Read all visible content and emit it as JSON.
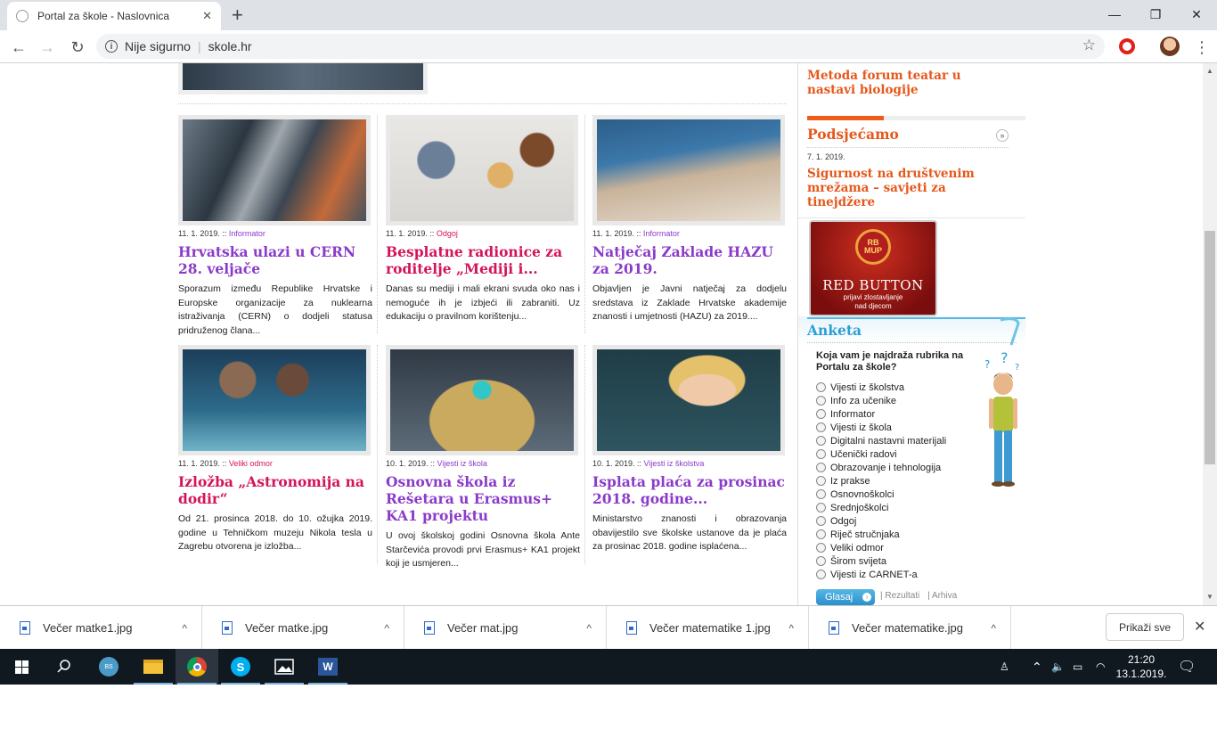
{
  "browser": {
    "tab_title": "Portal za škole - Naslovnica",
    "tab_close": "✕",
    "new_tab": "+",
    "security_text": "Nije sigurno",
    "url": "skole.hr",
    "minimize": "—",
    "maximize": "❐",
    "close": "✕"
  },
  "articles": [
    {
      "date": "11. 1. 2019. :: ",
      "category": "Informator",
      "title": "Hrvatska ulazi u CERN 28. veljače",
      "excerpt": "Sporazum između Republike Hrvatske i Europske organizacije za nuklearna istraživanja (CERN) o dodjeli statusa pridruženog člana..."
    },
    {
      "date": "11. 1. 2019. :: ",
      "category": "Odgoj",
      "title": "Besplatne radionice za roditelje „Mediji i...",
      "excerpt": "Danas su mediji i mali ekrani svuda oko nas i nemoguće ih je izbjeći ili zabraniti. Uz edukaciju o pravilnom korištenju..."
    },
    {
      "date": "11. 1. 2019. :: ",
      "category": "Informator",
      "title": "Natječaj Zaklade HAZU za 2019.",
      "excerpt": "Objavljen je Javni natječaj za dodjelu sredstava iz Zaklade Hrvatske akademije znanosti i umjetnosti (HAZU) za 2019...."
    },
    {
      "date": "11. 1. 2019. :: ",
      "category": "Veliki odmor",
      "title": "Izložba „Astronomija na dodir“",
      "excerpt": "Od 21. prosinca 2018. do 10. ožujka 2019. godine u Tehničkom muzeju Nikola tesla u Zagrebu otvorena je izložba..."
    },
    {
      "date": "10. 1. 2019. :: ",
      "category": "Vijesti iz škola",
      "title": "Osnovna škola iz Rešetara u Erasmus+ KA1 projektu",
      "excerpt": "U ovoj školskoj godini Osnovna škola Ante Starčevića provodi prvi Erasmus+ KA1 projekt koji je usmjeren..."
    },
    {
      "date": "10. 1. 2019. :: ",
      "category": "Vijesti iz školstva",
      "title": "Isplata plaća za prosinac 2018. godine...",
      "excerpt": "Ministarstvo znanosti i obrazovanja obavijestilo sve školske ustanove da je plaća za prosinac 2018. godine isplaćena..."
    }
  ],
  "sidebar": {
    "top_link": "Metoda forum teatar u nastavi biologije",
    "reminder_title": "Podsjećamo",
    "more": "»",
    "reminder_date": "7. 1. 2019.",
    "reminder_link": "Sigurnost na društvenim mrežama – savjeti za tinejdžere",
    "banner_logo_top": "RB",
    "banner_logo_bottom": "MUP",
    "banner_big": "RED BUTTON",
    "banner_small_1": "prijavi zlostavljanje",
    "banner_small_2": "nad djecom"
  },
  "poll": {
    "title": "Anketa",
    "question": "Koja vam je najdraža rubrika na Portalu za škole?",
    "options": [
      "Vijesti iz školstva",
      "Info za učenike",
      "Informator",
      "Vijesti iz škola",
      "Digitalni nastavni materijali",
      "Učenički radovi",
      "Obrazovanje i tehnologija",
      "Iz prakse",
      "Osnovnoškolci",
      "Srednjoškolci",
      "Odgoj",
      "Riječ stručnjaka",
      "Veliki odmor",
      "Širom svijeta",
      "Vijesti iz CARNET-a"
    ],
    "vote": "Glasaj",
    "vote_arrow": "›",
    "results": "| Rezultati",
    "archive": "| Arhiva"
  },
  "downloads": {
    "items": [
      "Večer matke1.jpg",
      "Večer matke.jpg",
      "Večer mat.jpg",
      "Večer matematike 1.jpg",
      "Večer matematike.jpg"
    ],
    "chevron": "^",
    "show_all": "Prikaži sve",
    "close": "✕"
  },
  "taskbar": {
    "time": "21:20",
    "date": "13.1.2019."
  }
}
